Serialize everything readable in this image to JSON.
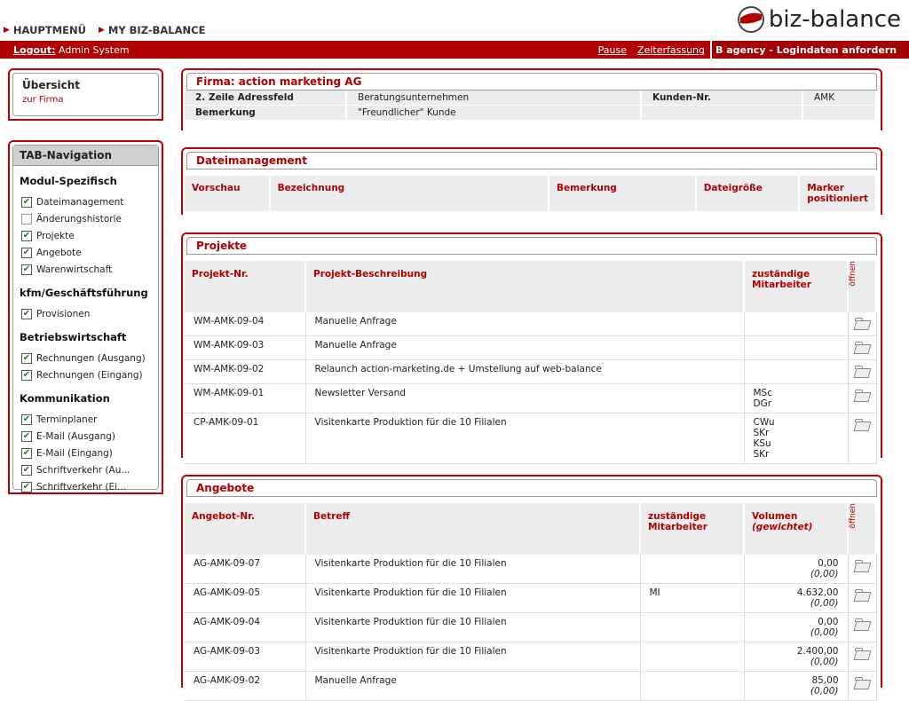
{
  "topnav": {
    "hauptmenu": "HAUPTMENÜ",
    "mybiz": "MY BIZ-BALANCE"
  },
  "logo": {
    "text": "biz-balance"
  },
  "redbar": {
    "logout": "Logout:",
    "user": "Admin System",
    "pause": "Pause",
    "zeiterfassung": "Zeiterfassung",
    "agency": "B agency - Logindaten anfordern"
  },
  "overview": {
    "title": "Übersicht",
    "sub": "zur Firma"
  },
  "tabnav": {
    "title": "TAB-Navigation",
    "sections": [
      {
        "name": "Modul-Spezifisch",
        "items": [
          {
            "label": "Dateimanagement",
            "checked": true
          },
          {
            "label": "Änderungshistorie",
            "checked": false
          },
          {
            "label": "Projekte",
            "checked": true
          },
          {
            "label": "Angebote",
            "checked": true
          },
          {
            "label": "Warenwirtschaft",
            "checked": true
          }
        ]
      },
      {
        "name": "kfm/Geschäftsführung",
        "items": [
          {
            "label": "Provisionen",
            "checked": true
          }
        ]
      },
      {
        "name": "Betriebswirtschaft",
        "items": [
          {
            "label": "Rechnungen (Ausgang)",
            "checked": true
          },
          {
            "label": "Rechnungen (Eingang)",
            "checked": true
          }
        ]
      },
      {
        "name": "Kommunikation",
        "items": [
          {
            "label": "Terminplaner",
            "checked": true
          },
          {
            "label": "E-Mail (Ausgang)",
            "checked": true
          },
          {
            "label": "E-Mail (Eingang)",
            "checked": true
          },
          {
            "label": "Schriftverkehr (Au...",
            "checked": true
          },
          {
            "label": "Schriftverkehr (Ei...",
            "checked": true
          }
        ]
      }
    ]
  },
  "firma": {
    "title": "Firma: action marketing AG",
    "adress_label": "2. Zeile Adressfeld",
    "adress_value": "Beratungsunternehmen",
    "kunden_label": "Kunden-Nr.",
    "kunden_value": "AMK",
    "bemerkung_label": "Bemerkung",
    "bemerkung_value": "\"Freundlicher\" Kunde"
  },
  "dateimanagement": {
    "title": "Dateimanagement",
    "headers": [
      "Vorschau",
      "Bezeichnung",
      "Bemerkung",
      "Dateigröße",
      "Marker positioniert"
    ]
  },
  "projekte": {
    "title": "Projekte",
    "headers": [
      "Projekt-Nr.",
      "Projekt-Beschreibung",
      "zuständige Mitarbeiter",
      "öffnen"
    ],
    "rows": [
      {
        "nr": "WM-AMK-09-04",
        "desc": "Manuelle Anfrage",
        "mitarbeiter": []
      },
      {
        "nr": "WM-AMK-09-03",
        "desc": "Manuelle Anfrage",
        "mitarbeiter": []
      },
      {
        "nr": "WM-AMK-09-02",
        "desc": "Relaunch action-marketing.de + Umstellung auf web-balance",
        "mitarbeiter": []
      },
      {
        "nr": "WM-AMK-09-01",
        "desc": "Newsletter Versand",
        "mitarbeiter": [
          "MSc",
          "DGr"
        ]
      },
      {
        "nr": "CP-AMK-09-01",
        "desc": "Visitenkarte Produktion für die 10 Filialen",
        "mitarbeiter": [
          "CWu",
          "SKr",
          "KSu",
          "SKr"
        ]
      }
    ]
  },
  "angebote": {
    "title": "Angebote",
    "headers": [
      "Angebot-Nr.",
      "Betreff",
      "zuständige Mitarbeiter",
      "Volumen",
      "(gewichtet)",
      "öffnen"
    ],
    "rows": [
      {
        "nr": "AG-AMK-09-07",
        "betreff": "Visitenkarte Produktion für die 10 Filialen",
        "mitarbeiter": "",
        "volumen": "0,00",
        "gewichtet": "(0,00)"
      },
      {
        "nr": "AG-AMK-09-05",
        "betreff": "Visitenkarte Produktion für die 10 Filialen",
        "mitarbeiter": "MI",
        "volumen": "4.632,00",
        "gewichtet": "(0,00)"
      },
      {
        "nr": "AG-AMK-09-04",
        "betreff": "Visitenkarte Produktion für die 10 Filialen",
        "mitarbeiter": "",
        "volumen": "0,00",
        "gewichtet": "(0,00)"
      },
      {
        "nr": "AG-AMK-09-03",
        "betreff": "Visitenkarte Produktion für die 10 Filialen",
        "mitarbeiter": "",
        "volumen": "2.400,00",
        "gewichtet": "(0,00)"
      },
      {
        "nr": "AG-AMK-09-02",
        "betreff": "Manuelle Anfrage",
        "mitarbeiter": "",
        "volumen": "85,00",
        "gewichtet": "(0,00)"
      }
    ]
  },
  "colors": {
    "brand_red": "#b00000",
    "header_grey": "#ececec"
  }
}
